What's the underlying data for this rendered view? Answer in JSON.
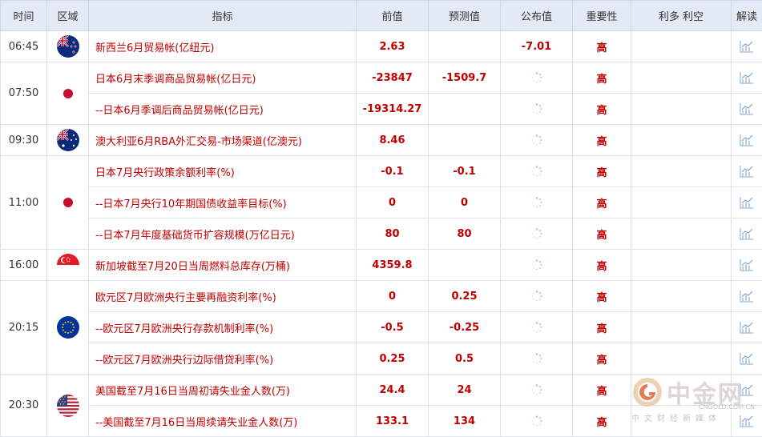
{
  "headers": {
    "time": "时间",
    "region": "区域",
    "indicator": "指标",
    "previous": "前值",
    "forecast": "预测值",
    "actual": "公布值",
    "importance": "重要性",
    "effect": "利多 利空",
    "interpret": "解读"
  },
  "colors": {
    "value_text": "#c00000",
    "header_bg": "#e4eaf5"
  },
  "groups": [
    {
      "time": "06:45",
      "flag": "new-zealand-flag-icon",
      "rows": [
        {
          "name": "新西兰6月贸易帐(亿纽元)",
          "previous": "2.63",
          "forecast": "",
          "actual": "-7.01",
          "importance": "高"
        }
      ]
    },
    {
      "time": "07:50",
      "flag": "japan-flag-icon",
      "rows": [
        {
          "name": "日本6月末季调商品贸易帐(亿日元)",
          "previous": "-23847",
          "forecast": "-1509.7",
          "actual": "",
          "importance": "高"
        },
        {
          "name": "--日本6月季调后商品贸易帐(亿日元)",
          "previous": "-19314.27",
          "forecast": "",
          "actual": "",
          "importance": "高"
        }
      ]
    },
    {
      "time": "09:30",
      "flag": "australia-flag-icon",
      "rows": [
        {
          "name": "澳大利亚6月RBA外汇交易-市场渠道(亿澳元)",
          "previous": "8.46",
          "forecast": "",
          "actual": "",
          "importance": "高"
        }
      ]
    },
    {
      "time": "11:00",
      "flag": "japan-flag-icon",
      "rows": [
        {
          "name": "日本7月央行政策余额利率(%)",
          "previous": "-0.1",
          "forecast": "-0.1",
          "actual": "",
          "importance": "高"
        },
        {
          "name": "--日本7月央行10年期国债收益率目标(%)",
          "previous": "0",
          "forecast": "0",
          "actual": "",
          "importance": "高"
        },
        {
          "name": "--日本7月年度基础货币扩容规模(万亿日元)",
          "previous": "80",
          "forecast": "80",
          "actual": "",
          "importance": "高"
        }
      ]
    },
    {
      "time": "16:00",
      "flag": "singapore-flag-icon",
      "rows": [
        {
          "name": "新加坡截至7月20日当周燃料总库存(万桶)",
          "previous": "4359.8",
          "forecast": "",
          "actual": "",
          "importance": "高"
        }
      ]
    },
    {
      "time": "20:15",
      "flag": "eu-flag-icon",
      "rows": [
        {
          "name": "欧元区7月欧洲央行主要再融资利率(%)",
          "previous": "0",
          "forecast": "0.25",
          "actual": "",
          "importance": "高"
        },
        {
          "name": "--欧元区7月欧洲央行存款机制利率(%)",
          "previous": "-0.5",
          "forecast": "-0.25",
          "actual": "",
          "importance": "高"
        },
        {
          "name": "--欧元区7月欧洲央行边际借贷利率(%)",
          "previous": "0.25",
          "forecast": "0.5",
          "actual": "",
          "importance": "高"
        }
      ]
    },
    {
      "time": "20:30",
      "flag": "usa-flag-icon",
      "rows": [
        {
          "name": "美国截至7月16日当周初请失业金人数(万)",
          "previous": "24.4",
          "forecast": "24",
          "actual": "",
          "importance": "高"
        },
        {
          "name": "--美国截至7月16日当周续请失业金人数(万)",
          "previous": "133.1",
          "forecast": "134",
          "actual": "",
          "importance": "高"
        }
      ]
    }
  ],
  "watermark": {
    "title": "中金网",
    "url": "CNGOLD.COM.CN",
    "subtitle": "中文财经新媒体"
  }
}
